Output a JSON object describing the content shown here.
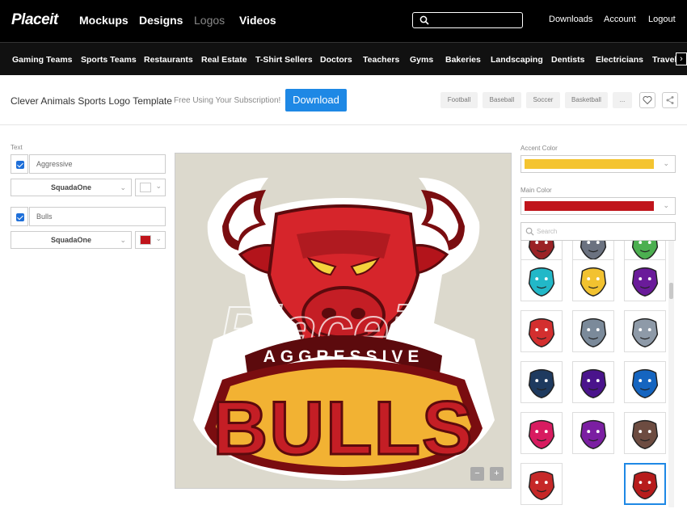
{
  "header": {
    "logo": "Placeit",
    "nav": [
      "Mockups",
      "Designs",
      "Logos",
      "Videos"
    ],
    "right": [
      "Downloads",
      "Account",
      "Logout"
    ]
  },
  "categories": [
    "Gaming Teams",
    "Sports Teams",
    "Restaurants",
    "Real Estate",
    "T-Shirt Sellers",
    "Doctors",
    "Teachers",
    "Gyms",
    "Bakeries",
    "Landscaping",
    "Dentists",
    "Electricians",
    "Travel"
  ],
  "toolbar": {
    "title": "Clever Animals Sports Logo Template",
    "subscription_note": "Free Using Your Subscription!",
    "download_label": "Download",
    "tags": [
      "Football",
      "Baseball",
      "Soccer",
      "Basketball",
      "..."
    ]
  },
  "editor": {
    "text_label": "Text",
    "fields": [
      {
        "value": "Aggressive",
        "font": "SquadaOne",
        "color": "#ffffff"
      },
      {
        "value": "Bulls",
        "font": "SquadaOne",
        "color": "#c0141b"
      }
    ]
  },
  "canvas": {
    "top_text": "AGGRESSIVE",
    "main_text": "BULLS",
    "watermark": "Placeit",
    "zoom_out": "−",
    "zoom_in": "+"
  },
  "colors": {
    "accent_label": "Accent Color",
    "accent": "#f4c430",
    "main_label": "Main Color",
    "main": "#c0141b"
  },
  "gallery": {
    "search_placeholder": "Search",
    "items": [
      {
        "icon": "bull-icon",
        "color": "#9b2226"
      },
      {
        "icon": "wolf-icon",
        "color": "#6b7280"
      },
      {
        "icon": "elephant-icon",
        "color": "#4caf50"
      },
      {
        "icon": "fish-icon",
        "color": "#22b8c8"
      },
      {
        "icon": "gorilla-icon",
        "color": "#f2c230"
      },
      {
        "icon": "horse-icon",
        "color": "#6a1b9a"
      },
      {
        "icon": "dragon-icon",
        "color": "#d32f2f"
      },
      {
        "icon": "rhino-icon",
        "color": "#7b8a9a"
      },
      {
        "icon": "elephant-icon",
        "color": "#8e9aa8"
      },
      {
        "icon": "panda-icon",
        "color": "#1e3a5f"
      },
      {
        "icon": "eagle-icon",
        "color": "#4a148c"
      },
      {
        "icon": "eagle-icon",
        "color": "#1565c0"
      },
      {
        "icon": "wolf-icon",
        "color": "#d81b60"
      },
      {
        "icon": "gorilla-icon",
        "color": "#7b1fa2"
      },
      {
        "icon": "dog-icon",
        "color": "#6d4c41"
      },
      {
        "icon": "bull-icon",
        "color": "#c62828"
      },
      {
        "icon": "bull-icon",
        "color": "#b71c1c"
      }
    ]
  }
}
